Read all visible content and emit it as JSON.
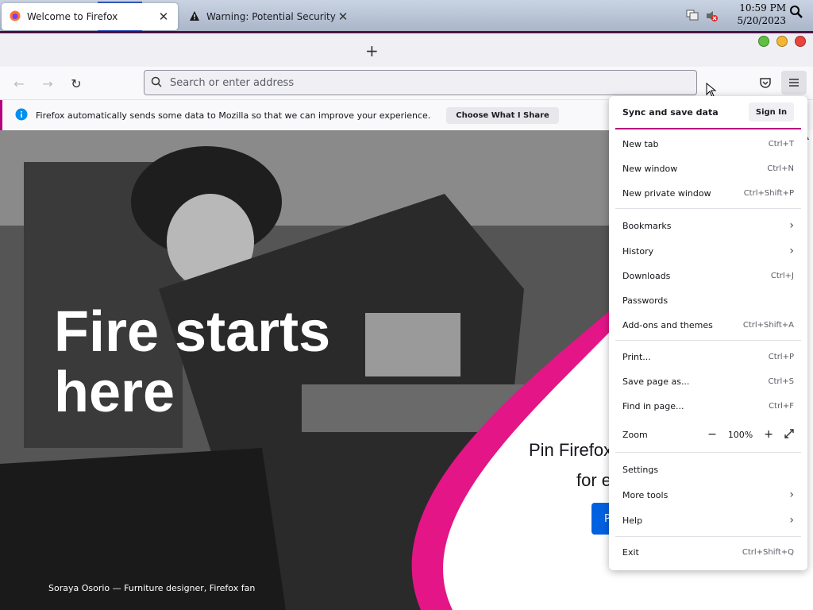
{
  "taskbar": {
    "icons": [
      "apple-icon",
      "file-manager-icon",
      "firefox-icon"
    ],
    "time": "10:59 PM",
    "date": "5/20/2023"
  },
  "tabs": [
    {
      "label": "Welcome to Firefox",
      "active": true
    },
    {
      "label": "Warning: Potential Security Risk",
      "active": false
    }
  ],
  "navbar": {
    "placeholder": "Search or enter address"
  },
  "notification": {
    "text": "Firefox automatically sends some data to Mozilla so that we can improve your experience.",
    "button": "Choose What I Share"
  },
  "hero": {
    "headline_line1": "Fire starts",
    "headline_line2": "here",
    "caption": "Soraya Osorio — Furniture designer, Firefox fan",
    "pin_line1": "Pin Firefox",
    "pin_line2": "for e",
    "pin_button": "P"
  },
  "menu": {
    "sync_label": "Sync and save data",
    "sign_in": "Sign In",
    "items": [
      {
        "label": "New tab",
        "shortcut": "Ctrl+T"
      },
      {
        "label": "New window",
        "shortcut": "Ctrl+N"
      },
      {
        "label": "New private window",
        "shortcut": "Ctrl+Shift+P"
      },
      {
        "label": "Bookmarks",
        "shortcut": ""
      },
      {
        "label": "History",
        "shortcut": ""
      },
      {
        "label": "Downloads",
        "shortcut": "Ctrl+J"
      },
      {
        "label": "Passwords",
        "shortcut": ""
      },
      {
        "label": "Add-ons and themes",
        "shortcut": "Ctrl+Shift+A"
      },
      {
        "label": "Print...",
        "shortcut": "Ctrl+P"
      },
      {
        "label": "Save page as...",
        "shortcut": "Ctrl+S"
      },
      {
        "label": "Find in page...",
        "shortcut": "Ctrl+F"
      },
      {
        "label": "Zoom",
        "shortcut": ""
      },
      {
        "label": "Settings",
        "shortcut": ""
      },
      {
        "label": "More tools",
        "shortcut": ""
      },
      {
        "label": "Help",
        "shortcut": ""
      },
      {
        "label": "Exit",
        "shortcut": "Ctrl+Shift+Q"
      }
    ],
    "zoom_value": "100%"
  },
  "colors": {
    "accent_pink": "#e31587",
    "firefox_blue": "#0061e0",
    "notification_bar": "#b5007f"
  }
}
